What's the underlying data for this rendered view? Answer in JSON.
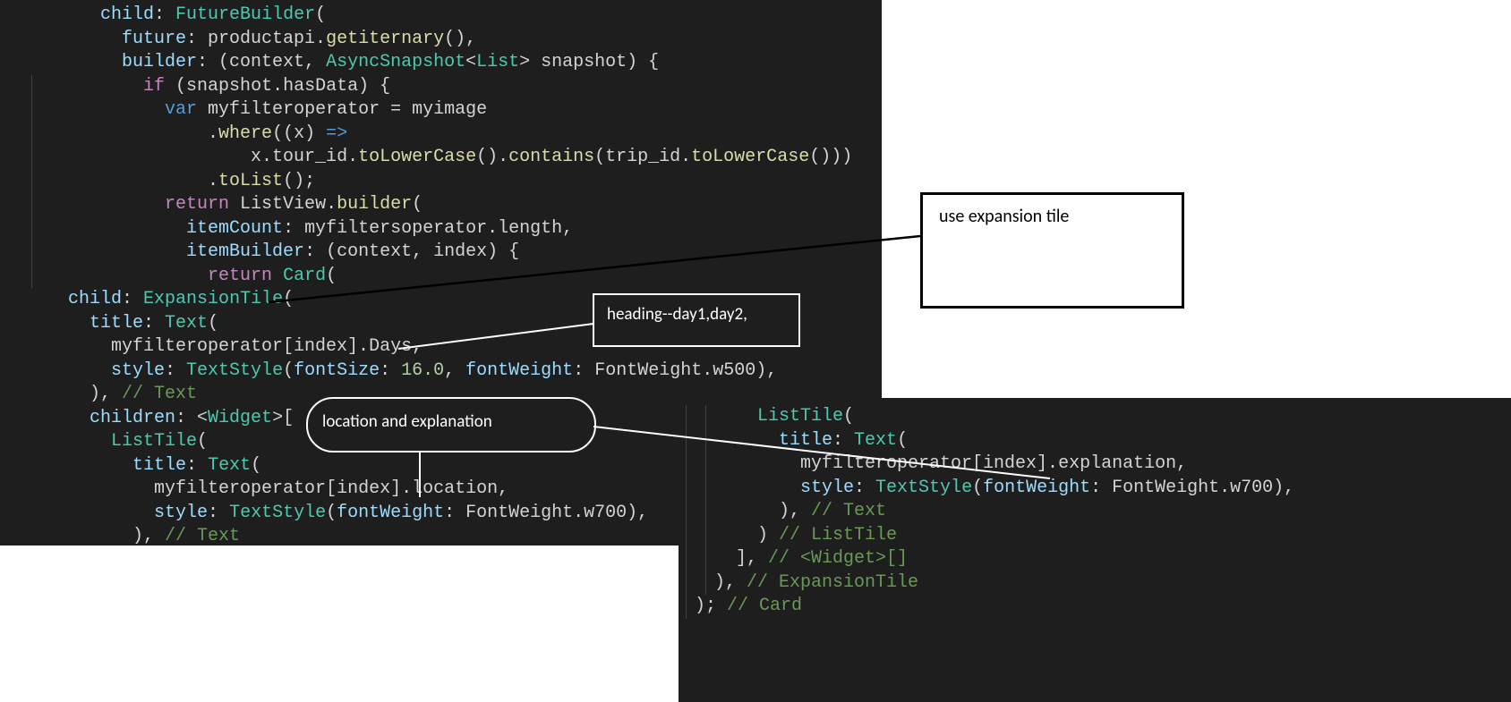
{
  "annotations": {
    "box1": "use  expansion tile",
    "box2": "heading--day1,day2,",
    "box3": "location and explanation"
  },
  "left": {
    "l1": {
      "a": "child",
      "b": ": ",
      "c": "FutureBuilder",
      "d": "("
    },
    "l2": {
      "a": "future",
      "b": ": productapi.",
      "c": "getiternary",
      "d": "(),"
    },
    "l3": {
      "a": "builder",
      "b": ": (context, ",
      "c": "AsyncSnapshot",
      "d": "<",
      "e": "List",
      "f": "> snapshot) {"
    },
    "l4": {
      "a": "if",
      "b": " (snapshot.hasData) {"
    },
    "l5": {
      "a": "var",
      "b": " myfilteroperator ",
      "c": "=",
      "d": " myimage"
    },
    "l6": {
      "a": ".",
      "b": "where",
      "c": "((x) ",
      "d": "=>"
    },
    "l7": {
      "a": "x.tour_id.",
      "b": "toLowerCase",
      "c": "().",
      "d": "contains",
      "e": "(trip_id.",
      "f": "toLowerCase",
      "g": "()))"
    },
    "l8": {
      "a": ".",
      "b": "toList",
      "c": "();"
    },
    "l9": {
      "a": "return",
      "b": " ListView.",
      "c": "builder",
      "d": "("
    },
    "l10": {
      "a": "itemCount",
      "b": ": myfiltersoperator.length,"
    },
    "l11": {
      "a": "itemBuilder",
      "b": ": (context, index) {"
    },
    "l12": {
      "a": "return",
      "b": " ",
      "c": "Card",
      "d": "("
    },
    "l13": {
      "a": "child",
      "b": ": ",
      "c": "ExpansionTile",
      "d": "("
    },
    "l14": {
      "a": "title",
      "b": ": ",
      "c": "Text",
      "d": "("
    },
    "l15": {
      "a": "myfilteroperator[index].Days,"
    },
    "l16": {
      "a": "style",
      "b": ": ",
      "c": "TextStyle",
      "d": "(",
      "e": "fontSize",
      "f": ": ",
      "g": "16.0",
      "h": ", ",
      "i": "fontWeight",
      "j": ": FontWeight.w500),"
    },
    "l17": {
      "a": "), ",
      "b": "// Text"
    },
    "l18": {
      "a": "children",
      "b": ": <",
      "c": "Widget",
      "d": ">["
    },
    "l19": {
      "a": "ListTile",
      "b": "("
    },
    "l20": {
      "a": "title",
      "b": ": ",
      "c": "Text",
      "d": "("
    },
    "l21": {
      "a": "myfilteroperator[index].location,"
    },
    "l22": {
      "a": "style",
      "b": ": ",
      "c": "TextStyle",
      "d": "(",
      "e": "fontWeight",
      "f": ": FontWeight.w700),"
    },
    "l23": {
      "a": "), ",
      "b": "// Text"
    }
  },
  "right": {
    "l1": {
      "a": "ListTile",
      "b": "("
    },
    "l2": {
      "a": "title",
      "b": ": ",
      "c": "Text",
      "d": "("
    },
    "l3": {
      "a": "myfilteroperator[index].explanation,"
    },
    "l4": {
      "a": "style",
      "b": ": ",
      "c": "TextStyle",
      "d": "(",
      "e": "fontWeight",
      "f": ": FontWeight.w700),"
    },
    "l5": {
      "a": "), ",
      "b": "// Text"
    },
    "l6": {
      "a": ") ",
      "b": "// ListTile"
    },
    "l7": {
      "a": "], ",
      "b": "// <Widget>[]"
    },
    "l8": {
      "a": "), ",
      "b": "// ExpansionTile"
    },
    "l9": {
      "a": "); ",
      "b": "// Card"
    }
  }
}
